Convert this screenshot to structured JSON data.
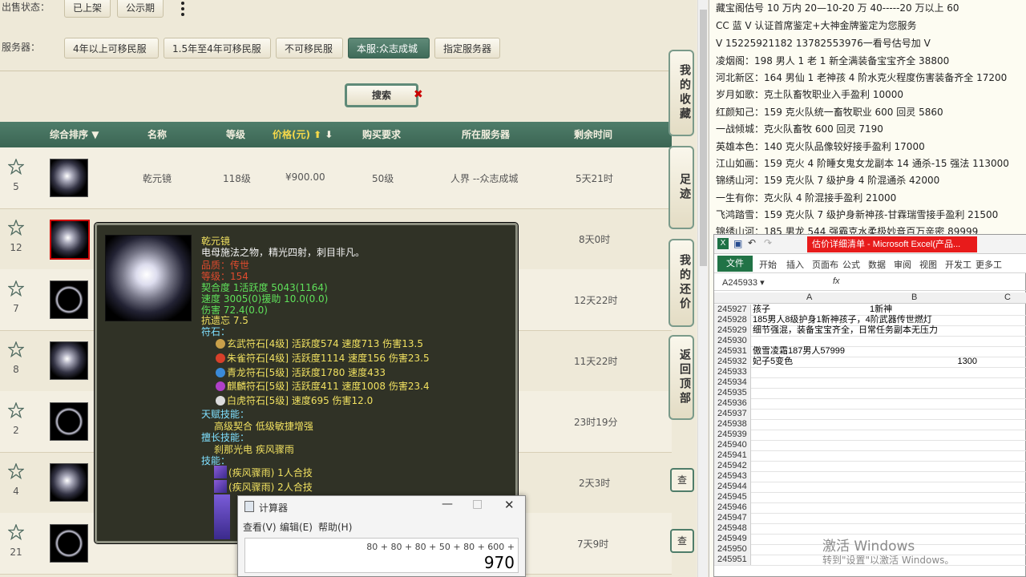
{
  "filters": {
    "status_label": "出售状态：",
    "status_buttons": [
      "已上架",
      "公示期"
    ],
    "more_icon": "more-vertical-icon",
    "server_label": "服务器：",
    "server_buttons": [
      "4年以上可移民服",
      "1.5年至4年可移民服",
      "不可移民服",
      "本服:众志成城",
      "指定服务器"
    ],
    "active_server": "本服:众志成城",
    "search_label": "搜索"
  },
  "table": {
    "headers": [
      "综合排序",
      "名称",
      "等级",
      "价格(元)",
      "购买要求",
      "所在服务器",
      "剩余时间"
    ],
    "rows": [
      {
        "rank": "5",
        "name": "乾元镜",
        "level": "118级",
        "price": "¥900.00",
        "req": "50级",
        "server": "人界 --众志成城",
        "time": "5天21时"
      },
      {
        "rank": "12",
        "name": "",
        "level": "",
        "price": "",
        "req": "",
        "server": "",
        "time": "8天0时"
      },
      {
        "rank": "7",
        "name": "",
        "level": "",
        "price": "",
        "req": "",
        "server": "",
        "time": "12天22时"
      },
      {
        "rank": "8",
        "name": "",
        "level": "",
        "price": "",
        "req": "",
        "server": "",
        "time": "11天22时"
      },
      {
        "rank": "2",
        "name": "",
        "level": "",
        "price": "",
        "req": "",
        "server": "",
        "time": "23时19分"
      },
      {
        "rank": "4",
        "name": "",
        "level": "",
        "price": "",
        "req": "",
        "server": "",
        "time": "2天3时"
      },
      {
        "rank": "21",
        "name": "",
        "level": "",
        "price": "",
        "req": "",
        "server": "",
        "time": "7天9时"
      }
    ]
  },
  "side_buttons": [
    "我的收藏",
    "足迹",
    "我的还价",
    "返回顶部"
  ],
  "view_button": "查",
  "tooltip": {
    "name": "乾元镜",
    "desc": "电母施法之物，精光四射，刺目非凡。",
    "quality": "品质：传世",
    "grade": "等级：154",
    "stat_fit": "契合度     1活跃度  5043(1164)",
    "stat_speed": "速度     3005(0)援助     10.0(0.0)",
    "stat_dmg": "伤害     72.4(0.0)",
    "stat_resist": "抗遗忘 7.5",
    "runes_label": "符石：",
    "runes": [
      {
        "text": "玄武符石[4级] 活跃度574 速度713 伤害13.5",
        "color": "#c9a04a"
      },
      {
        "text": "朱雀符石[4级] 活跃度1114 速度156 伤害23.5",
        "color": "#d8402a"
      },
      {
        "text": "青龙符石[5级] 活跃度1780 速度433",
        "color": "#3a8ad8"
      },
      {
        "text": "麒麟符石[5级] 活跃度411 速度1008 伤害23.4",
        "color": "#b040c8"
      },
      {
        "text": "白虎符石[5级] 速度695 伤害12.0",
        "color": "#dddddd"
      }
    ],
    "talent_label": "天赋技能：",
    "talent": "高级契合     低级敏捷增强",
    "special_label": "擅长技能：",
    "special": "刹那光电     疾风骤雨",
    "skills_label": "技能：",
    "skills": [
      "(疾风骤雨) 1人合技",
      "(疾风骤雨) 2人合技"
    ]
  },
  "calculator": {
    "title": "计算器",
    "menu": [
      "查看(V)",
      "编辑(E)",
      "帮助(H)"
    ],
    "expression": "80 + 80 + 80 + 50 + 80 + 600 +",
    "result": "970"
  },
  "right_text": {
    "red_lines": [
      "藏宝阁估号 10 万内 20—10-20 万 40-----20 万以上 60",
      "CC 蓝 V 认证首席鉴定+大神金牌鉴定为您服务",
      "V 15225921182      13782553976一看号估号加 V"
    ],
    "lines": [
      "凌烟阁：198 男人 1 老 1 新全满装备宝宝齐全 38800",
      "河北新区：164 男仙 1 老神孩 4 阶水克火程度伤害装备齐全 17200",
      "岁月如歌：克土队畜牧职业入手盈利 10000",
      "红颜知己：159 克火队统一畜牧职业 600 回灵 5860",
      "一战倾城：克火队畜牧 600 回灵 7190",
      "英雄本色：140 克火队品像较好接手盈利 17000",
      "江山如画：159 克火 4 阶睡女鬼女龙副本 14 通杀-15 强法 113000",
      "锦绣山河：159 克火队 7 级护身 4 阶混通杀 42000",
      "一生有你：克火队 4 阶混接手盈利 21000",
      "飞鸿踏雪：159 克火队 7 级护身新神孩-甘霖瑞雪接手盈利 21500",
      "锦绣山河：185 男龙 544 强霸克水柔极妙音百万亲密 89999"
    ]
  },
  "excel": {
    "title": "估价详细清单 - Microsoft Excel(产品...",
    "tabs": [
      "文件",
      "开始",
      "插入",
      "页面布",
      "公式",
      "数据",
      "审阅",
      "视图",
      "开发工",
      "更多工"
    ],
    "namebox": "A245933",
    "fx": "fx",
    "col_headers": [
      "A",
      "B",
      "C"
    ],
    "rows": [
      {
        "n": "245927",
        "a": "孩子",
        "b": "1新神"
      },
      {
        "n": "245928",
        "a": "185男人8级护身1新神孩子，4阶武器传世燃灯",
        "b": ""
      },
      {
        "n": "245929",
        "a": "细节强混，装备宝宝齐全，日常任务副本无压力",
        "b": ""
      },
      {
        "n": "245930",
        "a": "",
        "b": ""
      },
      {
        "n": "245931",
        "a": "傲雪凌霜187男人57999",
        "b": ""
      },
      {
        "n": "245932",
        "a": "妃子5变色",
        "b": "1300"
      },
      {
        "n": "245933",
        "a": "",
        "b": ""
      },
      {
        "n": "245934",
        "a": "",
        "b": ""
      },
      {
        "n": "245935",
        "a": "",
        "b": ""
      },
      {
        "n": "245936",
        "a": "",
        "b": ""
      },
      {
        "n": "245937",
        "a": "",
        "b": ""
      },
      {
        "n": "245938",
        "a": "",
        "b": ""
      },
      {
        "n": "245939",
        "a": "",
        "b": ""
      },
      {
        "n": "245940",
        "a": "",
        "b": ""
      },
      {
        "n": "245941",
        "a": "",
        "b": ""
      },
      {
        "n": "245942",
        "a": "",
        "b": ""
      },
      {
        "n": "245943",
        "a": "",
        "b": ""
      },
      {
        "n": "245944",
        "a": "",
        "b": ""
      },
      {
        "n": "245945",
        "a": "",
        "b": ""
      },
      {
        "n": "245946",
        "a": "",
        "b": ""
      },
      {
        "n": "245947",
        "a": "",
        "b": ""
      },
      {
        "n": "245948",
        "a": "",
        "b": ""
      },
      {
        "n": "245949",
        "a": "",
        "b": ""
      },
      {
        "n": "245950",
        "a": "",
        "b": ""
      },
      {
        "n": "245951",
        "a": "",
        "b": ""
      }
    ]
  },
  "watermark": {
    "line1": "激活 Windows",
    "line2": "转到\"设置\"以激活 Windows。"
  }
}
